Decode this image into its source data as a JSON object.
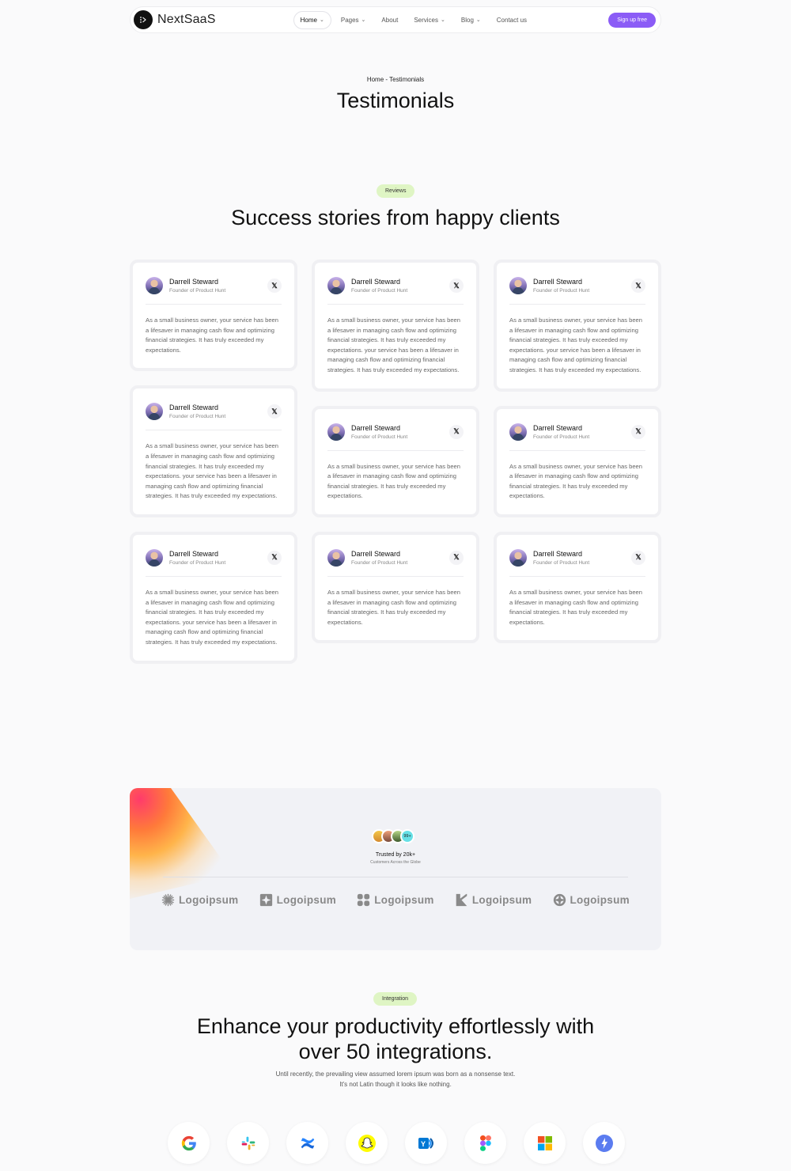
{
  "nav": {
    "brand": "NextSaaS",
    "items": [
      {
        "label": "Home",
        "dropdown": true,
        "active": true
      },
      {
        "label": "Pages",
        "dropdown": true
      },
      {
        "label": "About",
        "dropdown": false
      },
      {
        "label": "Services",
        "dropdown": true
      },
      {
        "label": "Blog",
        "dropdown": true
      },
      {
        "label": "Contact us",
        "dropdown": false
      }
    ],
    "cta": "Sign up free",
    "accent": "#8b5cf6"
  },
  "hero": {
    "breadcrumb": "Home - Testimonials",
    "title": "Testimonials"
  },
  "reviews": {
    "badge": "Reviews",
    "title": "Success stories from happy clients",
    "reviewer_name": "Darrell Steward",
    "reviewer_role": "Founder of Product Hunt",
    "social_icon": "x-icon",
    "short_text": "As a small business owner, your service has been a lifesaver in managing cash flow and optimizing financial strategies. It has truly exceeded my expectations.",
    "long_text": "As a small business owner, your service has been a lifesaver in managing cash flow and optimizing financial strategies. It has truly exceeded my expectations. your service has been a lifesaver in managing cash flow and optimizing financial strategies. It has truly exceeded my expectations.",
    "columns": [
      [
        "short",
        "long",
        "long"
      ],
      [
        "long",
        "short",
        "short"
      ],
      [
        "long",
        "short",
        "short"
      ]
    ]
  },
  "trust": {
    "count_badge": "99+",
    "title": "Trusted by 20k+",
    "subtitle": "Customers Across the Globe",
    "logos": [
      {
        "label": "Logoipsum",
        "icon": "starburst-logo-icon"
      },
      {
        "label": "Logoipsum",
        "icon": "square-star-logo-icon"
      },
      {
        "label": "Logoipsum",
        "icon": "clover-logo-icon"
      },
      {
        "label": "Logoipsum",
        "icon": "k-shape-logo-icon"
      },
      {
        "label": "Logoipsum",
        "icon": "ring-logo-icon"
      }
    ]
  },
  "integration": {
    "badge": "Integration",
    "title_line1": "Enhance your productivity effortlessly with",
    "title_line2": "over 50 integrations.",
    "subtitle_line1": "Until recently, the prevailing view assumed lorem ipsum was born as a nonsense text.",
    "subtitle_line2": "It's not Latin though it looks like nothing.",
    "apps": [
      "google-icon",
      "slack-icon",
      "confluence-icon",
      "snapchat-icon",
      "yammer-icon",
      "figma-icon",
      "microsoft-icon",
      "ftp-icon"
    ]
  }
}
